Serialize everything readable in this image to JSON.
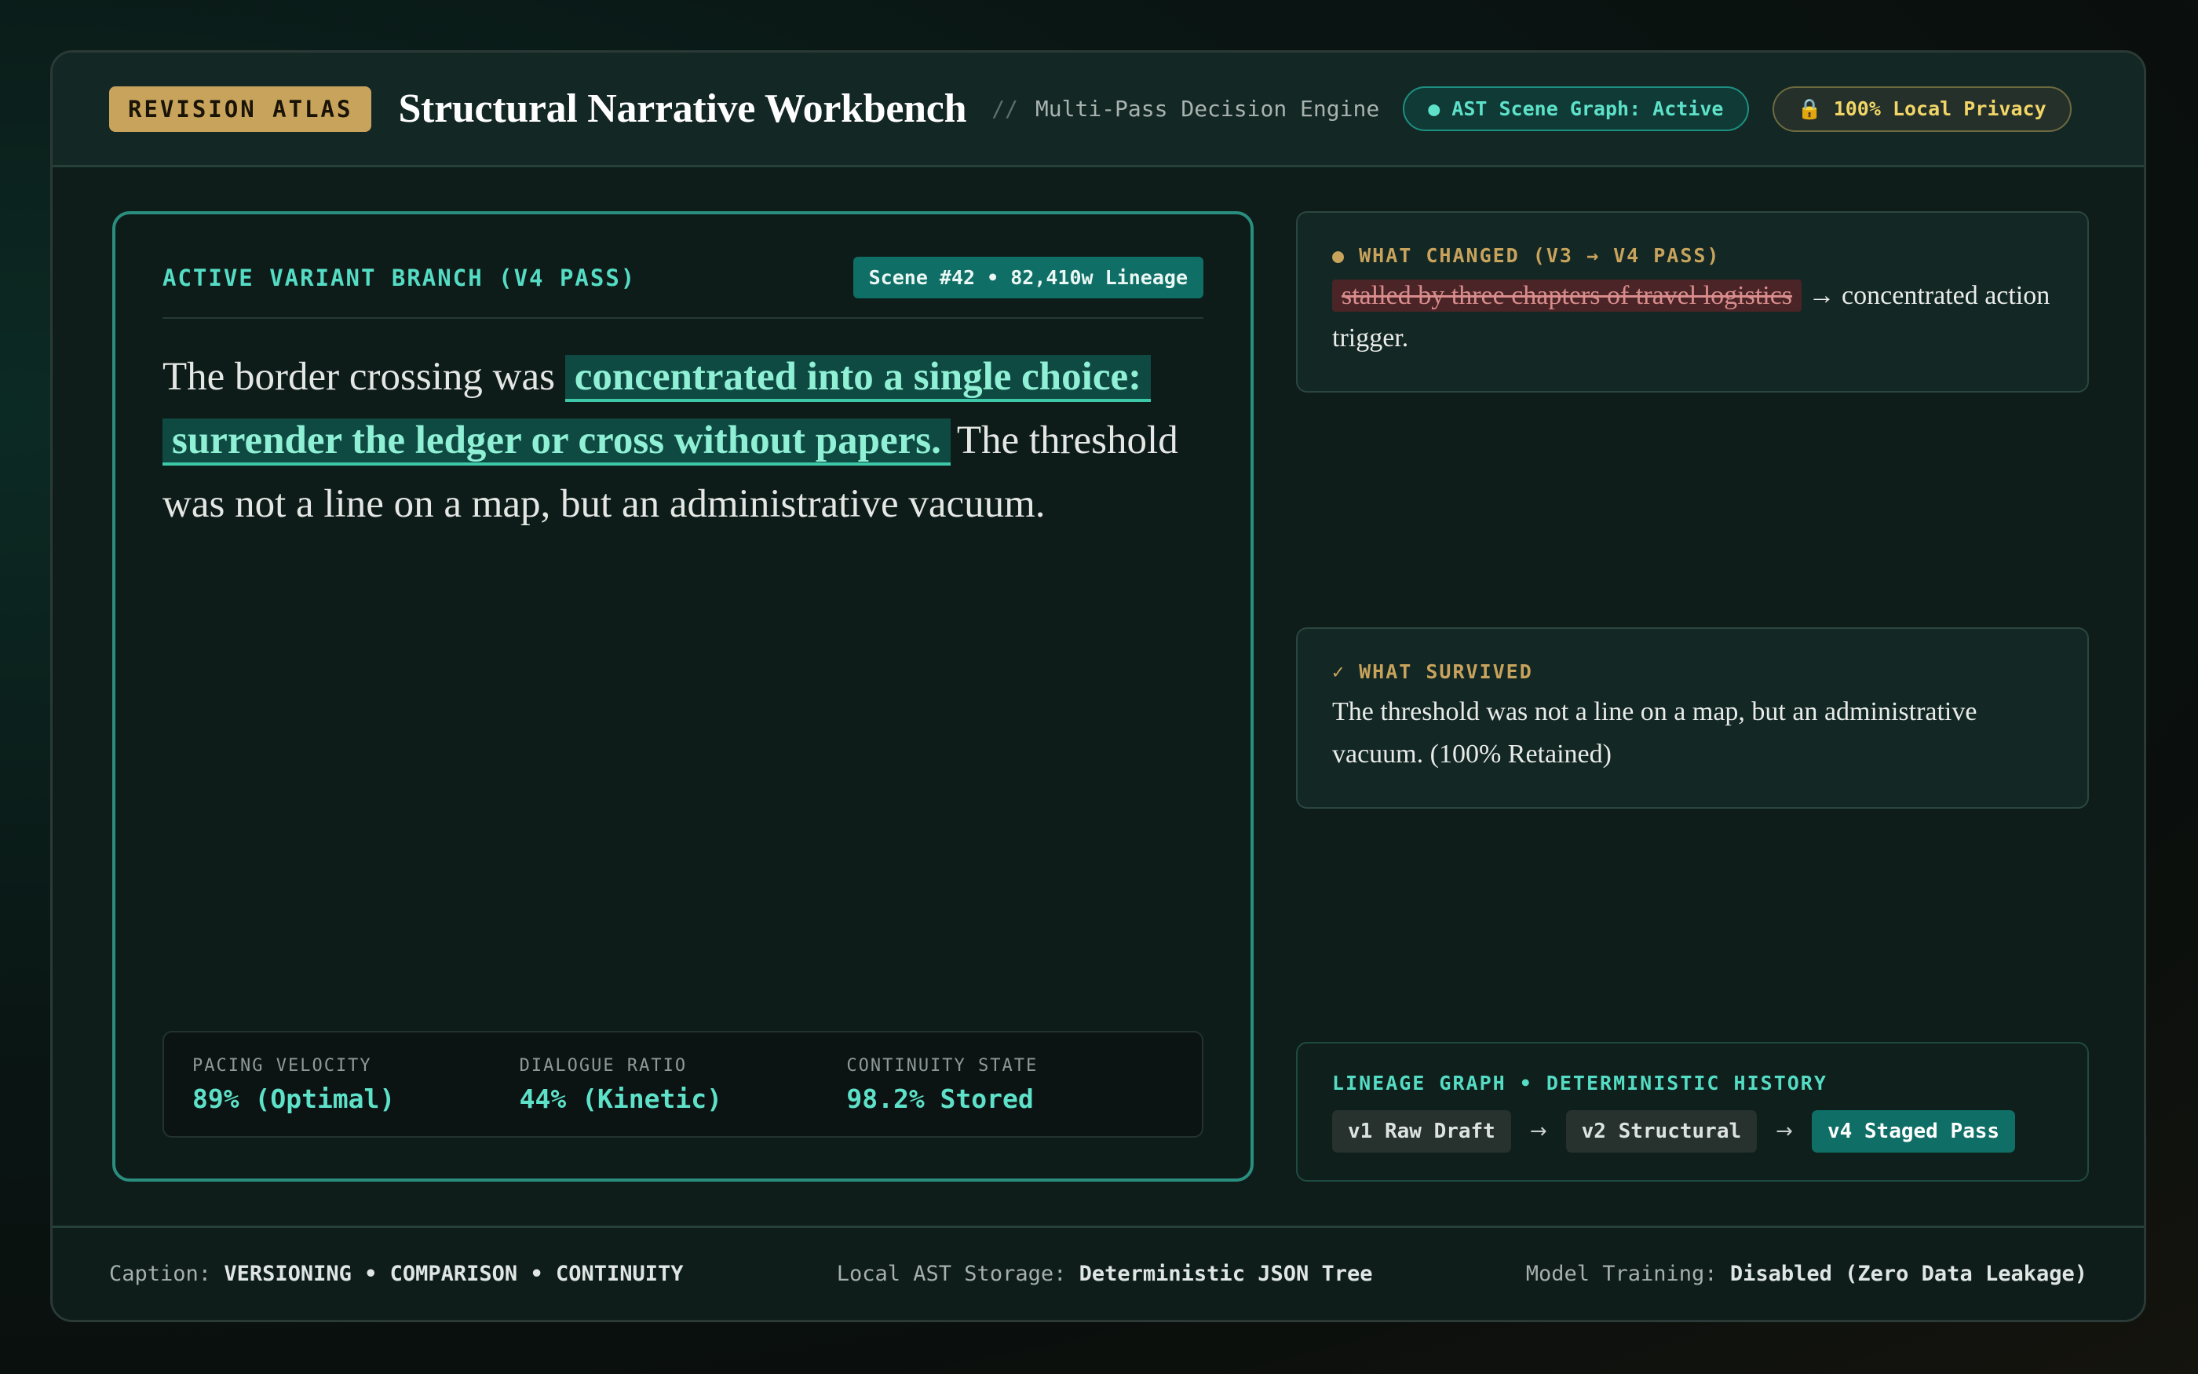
{
  "header": {
    "brand": "REVISION ATLAS",
    "title": "Structural Narrative Workbench",
    "separator": "//",
    "subtitle": "Multi-Pass Decision Engine",
    "status_pill": "● AST Scene Graph: Active",
    "privacy_icon": "lock-icon",
    "privacy_pill": "100% Local Privacy"
  },
  "main_card": {
    "label": "ACTIVE VARIANT BRANCH (V4 PASS)",
    "scene_badge": "Scene #42 • 82,410w Lineage",
    "prose_before": "The border crossing was ",
    "prose_highlight": "concentrated into a single choice: surrender the ledger or cross without papers.",
    "prose_after": "The threshold was not a line on a map, but an administrative vacuum.",
    "metrics": [
      {
        "label": "PACING VELOCITY",
        "value": "89% (Optimal)"
      },
      {
        "label": "DIALOGUE RATIO",
        "value": "44% (Kinetic)"
      },
      {
        "label": "CONTINUITY STATE",
        "value": "98.2% Stored"
      }
    ]
  },
  "what_changed": {
    "label": "● WHAT CHANGED (V3 → V4 PASS)",
    "removed": "stalled by three chapters of travel logistics",
    "added": "→ concentrated action trigger."
  },
  "what_survived": {
    "label": "✓ WHAT SURVIVED",
    "text": "The threshold was not a line on a map, but an administrative vacuum. (100% Retained)"
  },
  "lineage": {
    "label": "LINEAGE GRAPH • DETERMINISTIC HISTORY",
    "arrow": "→",
    "versions": [
      "v1 Raw Draft",
      "v2 Structural",
      "v4 Staged Pass"
    ]
  },
  "footer": {
    "caption_label": "Caption:",
    "caption_value": "VERSIONING • COMPARISON • CONTINUITY",
    "storage_label": "Local AST Storage:",
    "storage_value": "Deterministic JSON Tree",
    "training_label": "Model Training:",
    "training_value": "Disabled (Zero Data Leakage)"
  },
  "colors": {
    "accent": "#2a8e7f",
    "accent_text": "#5ee1c9",
    "brand_gold": "#c8a35c",
    "privacy_yellow": "#f1d566",
    "removed_red": "#4a2426"
  }
}
